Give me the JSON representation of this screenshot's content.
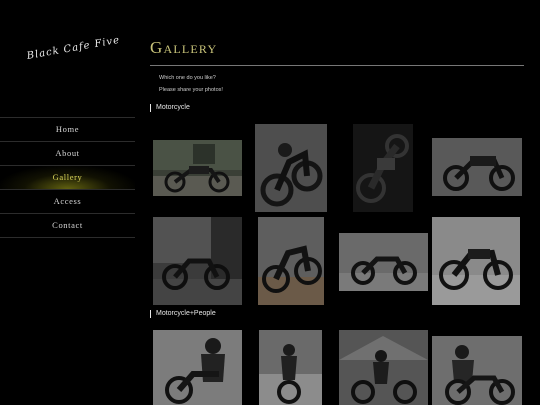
{
  "logo": {
    "text": "Black Cafe Five"
  },
  "nav": {
    "items": [
      {
        "label": "Home",
        "active": false
      },
      {
        "label": "About",
        "active": false
      },
      {
        "label": "Gallery",
        "active": true
      },
      {
        "label": "Access",
        "active": false
      },
      {
        "label": "Contact",
        "active": false
      }
    ]
  },
  "page": {
    "title": "Gallery",
    "intro_line1": "Which one do you like?",
    "intro_line2": "Please share your photos!"
  },
  "sections": [
    {
      "label": "Motorcycle"
    },
    {
      "label": "Motorcycle+People"
    }
  ]
}
